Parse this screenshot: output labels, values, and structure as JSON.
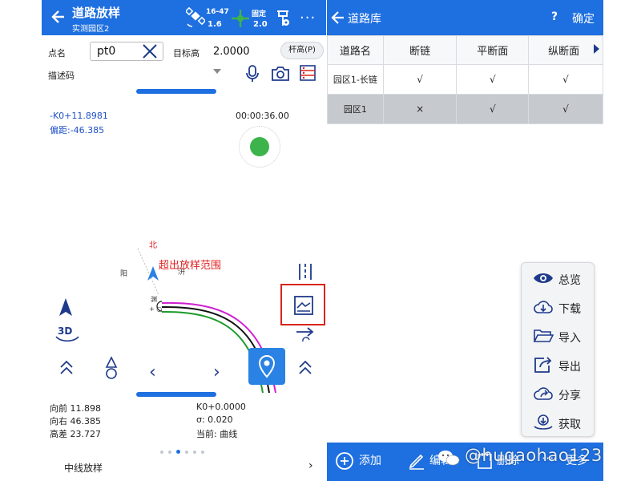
{
  "left_app": {
    "header": {
      "title": "道路放样",
      "subtitle": "实测园区2",
      "satellites": "16-47",
      "pdop": "1.6",
      "solution_status": "固定",
      "solution_age": "2.0",
      "more": "···"
    },
    "form": {
      "point_name_label": "点名",
      "point_name_value": "pt0",
      "target_height_label": "目标高",
      "target_height_value": "2.0000",
      "pole_height_button": "杆高(P)",
      "description_label": "描述码"
    },
    "status": {
      "station": "-K0+11.8981",
      "offset": "偏距:-46.385",
      "timer": "00:00:36.00"
    },
    "map": {
      "north_label": "北",
      "out_of_range": "超出放样范围",
      "toggle_3d": "3D",
      "chevron_left": "‹",
      "chevron_right": "›"
    },
    "info": {
      "forward": "向前 11.898",
      "right": "向右 46.385",
      "height_diff": "高差 23.727",
      "chainage": "K0+0.0000",
      "sigma": "σ: 0.020",
      "current": "当前: 曲线"
    },
    "page_dots": {
      "count": 6,
      "active": 2
    },
    "bottom": {
      "label": "中线放样",
      "arrow": "›"
    }
  },
  "right_app": {
    "header": {
      "title": "道路库",
      "help": "?",
      "confirm": "确定"
    },
    "table": {
      "columns": [
        "道路名",
        "断链",
        "平断面",
        "纵断面"
      ],
      "rows": [
        [
          "园区1-长链",
          "√",
          "√",
          "√"
        ],
        [
          "园区1",
          "×",
          "√",
          "√"
        ]
      ],
      "selected_row": 1
    },
    "menu": [
      {
        "label": "总览",
        "icon": "eye-icon"
      },
      {
        "label": "下载",
        "icon": "cloud-download-icon"
      },
      {
        "label": "导入",
        "icon": "folder-open-icon"
      },
      {
        "label": "导出",
        "icon": "export-icon"
      },
      {
        "label": "分享",
        "icon": "cloud-share-icon"
      },
      {
        "label": "获取",
        "icon": "fetch-icon"
      }
    ],
    "bottom": {
      "add": "添加",
      "edit": "编辑",
      "delete": "删除",
      "more": "更多"
    }
  },
  "watermark": "@hugaohao123",
  "colors": {
    "primary": "#1e6fe0",
    "alert": "#d9251c",
    "gps_fix": "#3cb44b",
    "selected_row": "#c6c9ce"
  }
}
